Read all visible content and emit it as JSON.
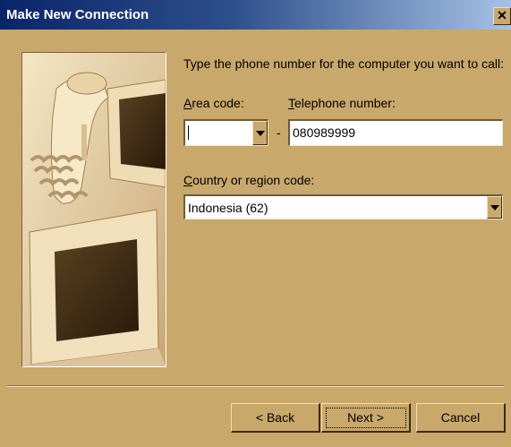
{
  "window": {
    "title": "Make New Connection",
    "close_glyph": "✕"
  },
  "form": {
    "instruction": "Type the phone number for the computer you want to call:",
    "area_code_label": "Area code:",
    "area_code_value": "",
    "separator": "-",
    "telephone_label": "Telephone number:",
    "telephone_value": "080989999",
    "country_label": "Country or region code:",
    "country_value": "Indonesia (62)"
  },
  "buttons": {
    "back": "< Back",
    "next": "Next >",
    "cancel": "Cancel"
  },
  "icons": {
    "photo": "computers-telephone-image",
    "dropdown": "chevron-down-icon"
  },
  "colors": {
    "title_bar_start": "#0a246a",
    "title_bar_end": "#a6c1e6",
    "dialog_bg": "#c9a86b"
  }
}
